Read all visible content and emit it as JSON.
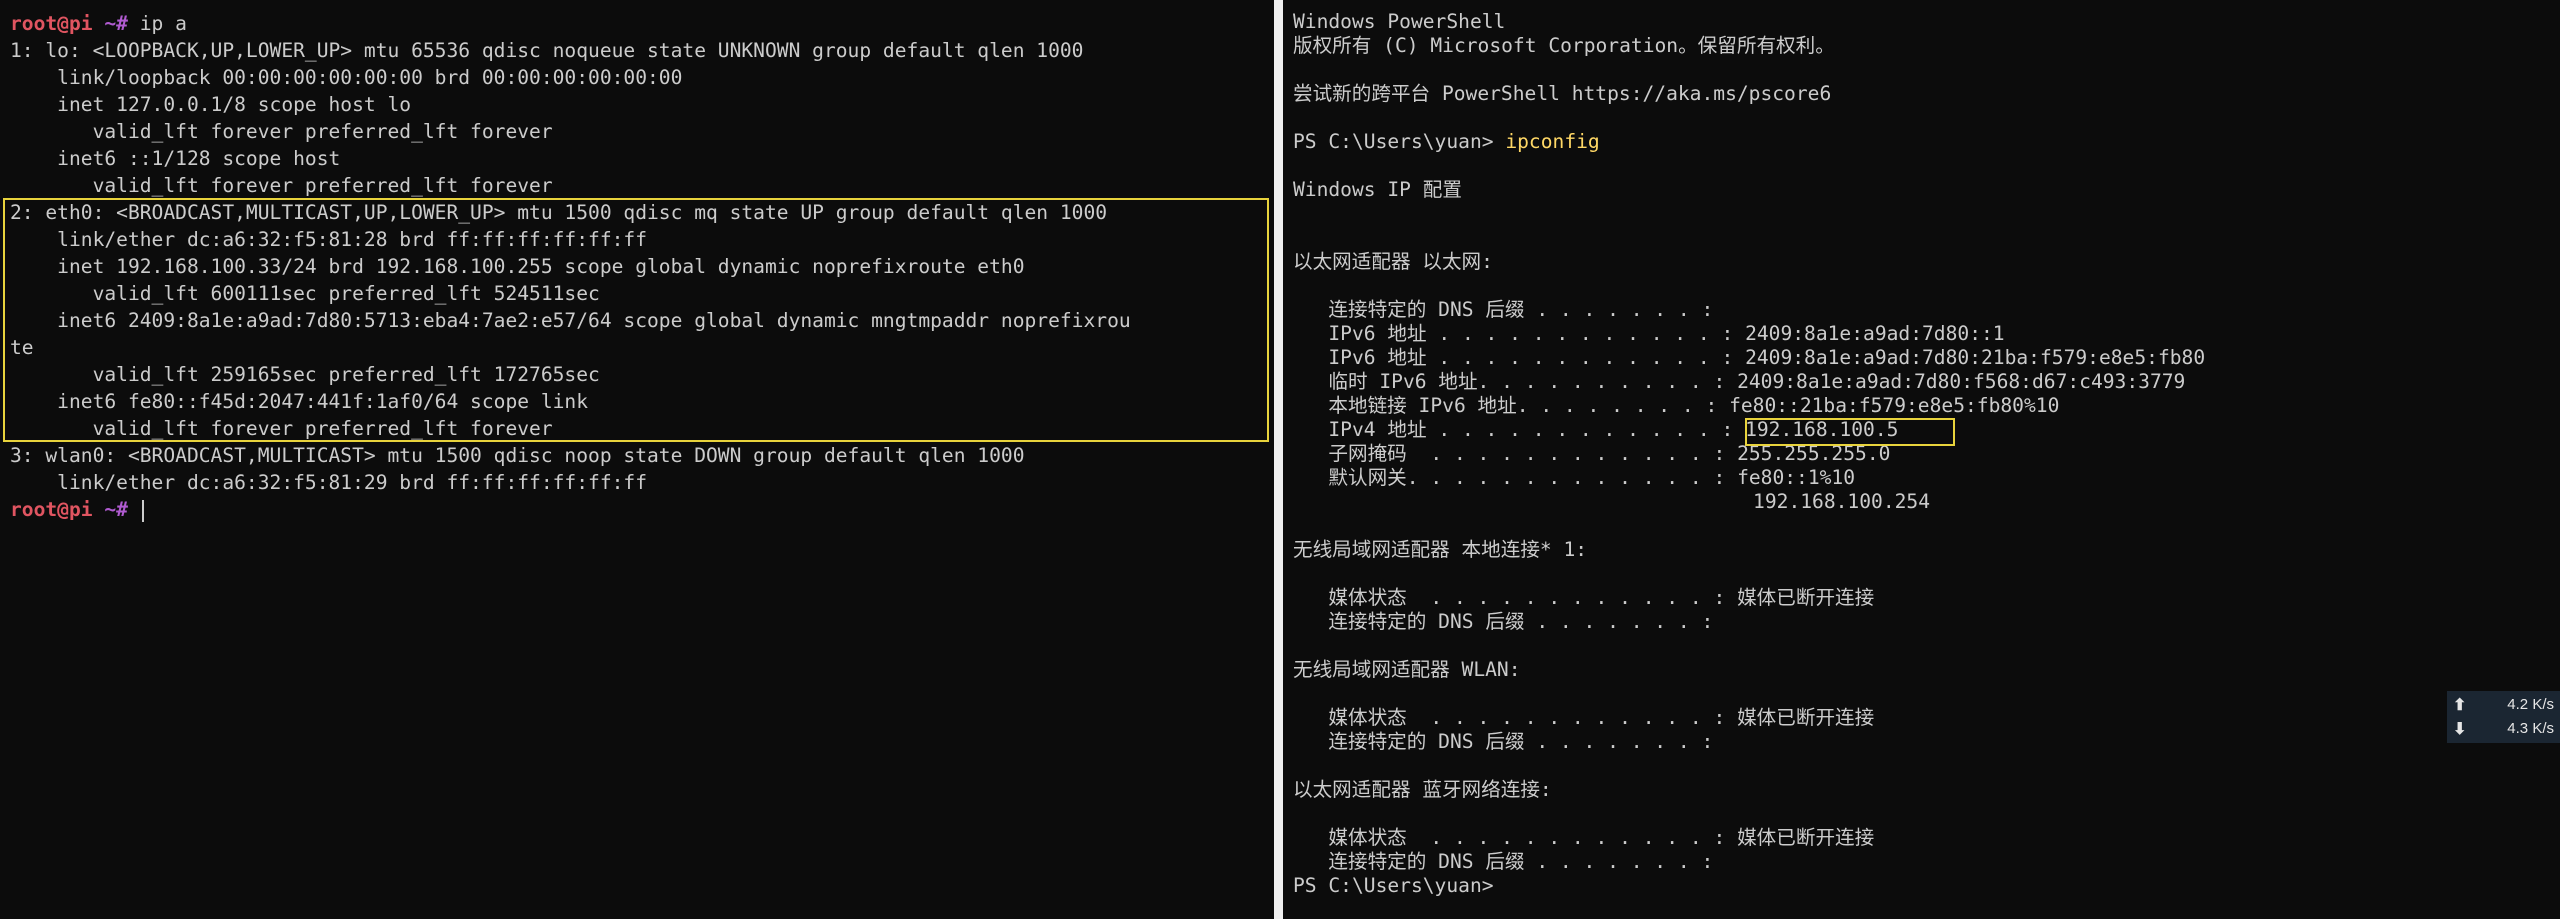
{
  "left_terminal": {
    "prompt_user": "root@pi",
    "prompt_path": "~#",
    "command": "ip a",
    "output": [
      "1: lo: <LOOPBACK,UP,LOWER_UP> mtu 65536 qdisc noqueue state UNKNOWN group default qlen 1000",
      "    link/loopback 00:00:00:00:00:00 brd 00:00:00:00:00:00",
      "    inet 127.0.0.1/8 scope host lo",
      "       valid_lft forever preferred_lft forever",
      "    inet6 ::1/128 scope host",
      "       valid_lft forever preferred_lft forever",
      "2: eth0: <BROADCAST,MULTICAST,UP,LOWER_UP> mtu 1500 qdisc mq state UP group default qlen 1000",
      "    link/ether dc:a6:32:f5:81:28 brd ff:ff:ff:ff:ff:ff",
      "    inet 192.168.100.33/24 brd 192.168.100.255 scope global dynamic noprefixroute eth0",
      "       valid_lft 600111sec preferred_lft 524511sec",
      "    inet6 2409:8a1e:a9ad:7d80:5713:eba4:7ae2:e57/64 scope global dynamic mngtmpaddr noprefixrou",
      "te",
      "       valid_lft 259165sec preferred_lft 172765sec",
      "    inet6 fe80::f45d:2047:441f:1af0/64 scope link",
      "       valid_lft forever preferred_lft forever",
      "3: wlan0: <BROADCAST,MULTICAST> mtu 1500 qdisc noop state DOWN group default qlen 1000",
      "    link/ether dc:a6:32:f5:81:29 brd ff:ff:ff:ff:ff:ff"
    ]
  },
  "right_terminal": {
    "header": [
      "Windows PowerShell",
      "版权所有 (C) Microsoft Corporation。保留所有权利。",
      "",
      "尝试新的跨平台 PowerShell https://aka.ms/pscore6",
      ""
    ],
    "prompt": "PS C:\\Users\\yuan> ",
    "command": "ipconfig",
    "output": [
      "",
      "Windows IP 配置",
      "",
      "",
      "以太网适配器 以太网:",
      "",
      "   连接特定的 DNS 后缀 . . . . . . . :",
      "   IPv6 地址 . . . . . . . . . . . . : 2409:8a1e:a9ad:7d80::1",
      "   IPv6 地址 . . . . . . . . . . . . : 2409:8a1e:a9ad:7d80:21ba:f579:e8e5:fb80",
      "   临时 IPv6 地址. . . . . . . . . . : 2409:8a1e:a9ad:7d80:f568:d67:c493:3779",
      "   本地链接 IPv6 地址. . . . . . . . : fe80::21ba:f579:e8e5:fb80%10",
      "   IPv4 地址 . . . . . . . . . . . . : 192.168.100.5",
      "   子网掩码  . . . . . . . . . . . . : 255.255.255.0",
      "   默认网关. . . . . . . . . . . . . : fe80::1%10",
      "                                       192.168.100.254",
      "",
      "无线局域网适配器 本地连接* 1:",
      "",
      "   媒体状态  . . . . . . . . . . . . : 媒体已断开连接",
      "   连接特定的 DNS 后缀 . . . . . . . :",
      "",
      "无线局域网适配器 WLAN:",
      "",
      "   媒体状态  . . . . . . . . . . . . : 媒体已断开连接",
      "   连接特定的 DNS 后缀 . . . . . . . :",
      "",
      "以太网适配器 蓝牙网络连接:",
      "",
      "   媒体状态  . . . . . . . . . . . . : 媒体已断开连接",
      "   连接特定的 DNS 后缀 . . . . . . . :"
    ],
    "final_prompt": "PS C:\\Users\\yuan>"
  },
  "net_speed": {
    "upload": "4.2 K/s",
    "download": "4.3 K/s",
    "upload_icon": "up-arrow-icon",
    "download_icon": "down-arrow-icon"
  },
  "colors": {
    "highlight_box": "#e8d33c",
    "prompt_user": "#e05561",
    "prompt_path": "#b05bd0",
    "command": "#ffd866"
  }
}
